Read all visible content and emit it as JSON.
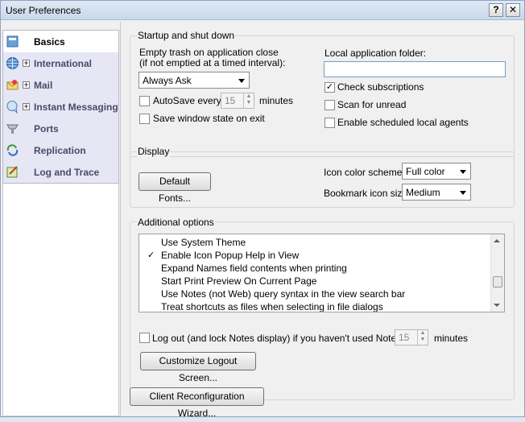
{
  "window": {
    "title": "User Preferences",
    "help": "?",
    "close": "✕"
  },
  "sidebar": {
    "items": [
      {
        "label": "Basics",
        "icon": "basics-icon",
        "expandable": false,
        "active": true
      },
      {
        "label": "International",
        "icon": "globe-icon",
        "expandable": true,
        "active": false
      },
      {
        "label": "Mail",
        "icon": "mail-icon",
        "expandable": true,
        "active": false
      },
      {
        "label": "Instant Messaging",
        "icon": "chat-icon",
        "expandable": true,
        "active": false
      },
      {
        "label": "Ports",
        "icon": "ports-icon",
        "expandable": false,
        "active": false
      },
      {
        "label": "Replication",
        "icon": "replication-icon",
        "expandable": false,
        "active": false
      },
      {
        "label": "Log and Trace",
        "icon": "log-icon",
        "expandable": false,
        "active": false
      }
    ]
  },
  "startup": {
    "title": "Startup and shut down",
    "trash_label1": "Empty trash on application close",
    "trash_label2": "(if not emptied at a timed interval):",
    "trash_value": "Always Ask",
    "autosave_label": "AutoSave every",
    "autosave_checked": false,
    "autosave_value": "15",
    "minutes": "minutes",
    "save_window_label": "Save window state on exit",
    "save_window_checked": false,
    "local_folder_label": "Local application folder:",
    "local_folder_value": "",
    "check_subscriptions_label": "Check subscriptions",
    "check_subscriptions_checked": true,
    "scan_unread_label": "Scan for unread",
    "scan_unread_checked": false,
    "scheduled_agents_label": "Enable scheduled local agents",
    "scheduled_agents_checked": false
  },
  "display": {
    "title": "Display",
    "default_fonts_label": "Default Fonts...",
    "icon_scheme_label": "Icon color scheme",
    "icon_scheme_value": "Full color",
    "bookmark_size_label": "Bookmark icon size",
    "bookmark_size_value": "Medium"
  },
  "additional": {
    "title": "Additional options",
    "options": [
      {
        "label": "Use System Theme",
        "checked": false
      },
      {
        "label": "Enable Icon Popup Help in View",
        "checked": true
      },
      {
        "label": "Expand Names field contents when printing",
        "checked": false
      },
      {
        "label": "Start Print Preview On Current Page",
        "checked": false
      },
      {
        "label": "Use Notes (not Web) query syntax in the view search bar",
        "checked": false
      },
      {
        "label": "Treat shortcuts as files when selecting in file dialogs",
        "checked": false
      }
    ],
    "logout_label": "Log out (and lock Notes display) if you haven't used Notes for",
    "logout_checked": false,
    "logout_value": "15",
    "minutes": "minutes",
    "customize_logout_label": "Customize Logout Screen..."
  },
  "footer": {
    "reconfig_label": "Client Reconfiguration Wizard..."
  }
}
